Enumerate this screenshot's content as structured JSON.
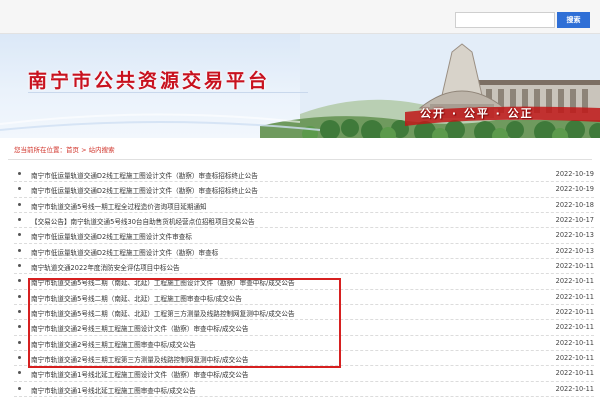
{
  "search": {
    "placeholder": "",
    "button_label": "搜索"
  },
  "banner": {
    "title": "南宁市公共资源交易平台",
    "slogan": "公开 · 公平 · 公正"
  },
  "breadcrumb": {
    "label": "您当前所在位置：",
    "home": "首页",
    "separator": " > ",
    "current": "站内搜索"
  },
  "colors": {
    "accent": "#2f6fd6",
    "brand_red": "#c8121f",
    "highlight": "#d62020"
  },
  "news": [
    {
      "title": "南宁市低运量轨道交通D2线工程施工图设计文件（勘察）审查标招标终止公告",
      "date": "2022-10-19"
    },
    {
      "title": "南宁市低运量轨道交通D2线工程施工图设计文件（勘察）审查标招标终止公告",
      "date": "2022-10-19"
    },
    {
      "title": "南宁市轨道交通5号线一期工程全过程造价咨询项目延期通知",
      "date": "2022-10-18"
    },
    {
      "title": "【交易公告】南宁轨道交通5号线30台自助售货机经营点位招租项目交易公告",
      "date": "2022-10-17"
    },
    {
      "title": "南宁市低运量轨道交通D2线工程施工图设计文件审查标",
      "date": "2022-10-13"
    },
    {
      "title": "南宁市低运量轨道交通D2线工程施工图设计文件（勘察）审查标",
      "date": "2022-10-13"
    },
    {
      "title": "南宁轨道交通2022年度消防安全评估项目中标公告",
      "date": "2022-10-11"
    },
    {
      "title": "南宁市轨道交通5号线二期（南延、北延）工程施工图设计文件（勘察）审查中标/成交公告",
      "date": "2022-10-11"
    },
    {
      "title": "南宁市轨道交通5号线二期（南延、北延）工程施工图审查中标/成交公告",
      "date": "2022-10-11"
    },
    {
      "title": "南宁市轨道交通5号线二期（南延、北延）工程第三方测量及线路控制网复测中标/成交公告",
      "date": "2022-10-11"
    },
    {
      "title": "南宁市轨道交通2号线三期工程施工图设计文件（勘察）审查中标/成交公告",
      "date": "2022-10-11"
    },
    {
      "title": "南宁市轨道交通2号线三期工程施工图审查中标/成交公告",
      "date": "2022-10-11"
    },
    {
      "title": "南宁市轨道交通2号线三期工程第三方测量及线路控制网复测中标/成交公告",
      "date": "2022-10-11"
    },
    {
      "title": "南宁市轨道交通1号线北延工程施工图设计文件（勘察）审查中标/成交公告",
      "date": "2022-10-11"
    },
    {
      "title": "南宁市轨道交通1号线北延工程施工图审查中标/成交公告",
      "date": "2022-10-11"
    }
  ]
}
